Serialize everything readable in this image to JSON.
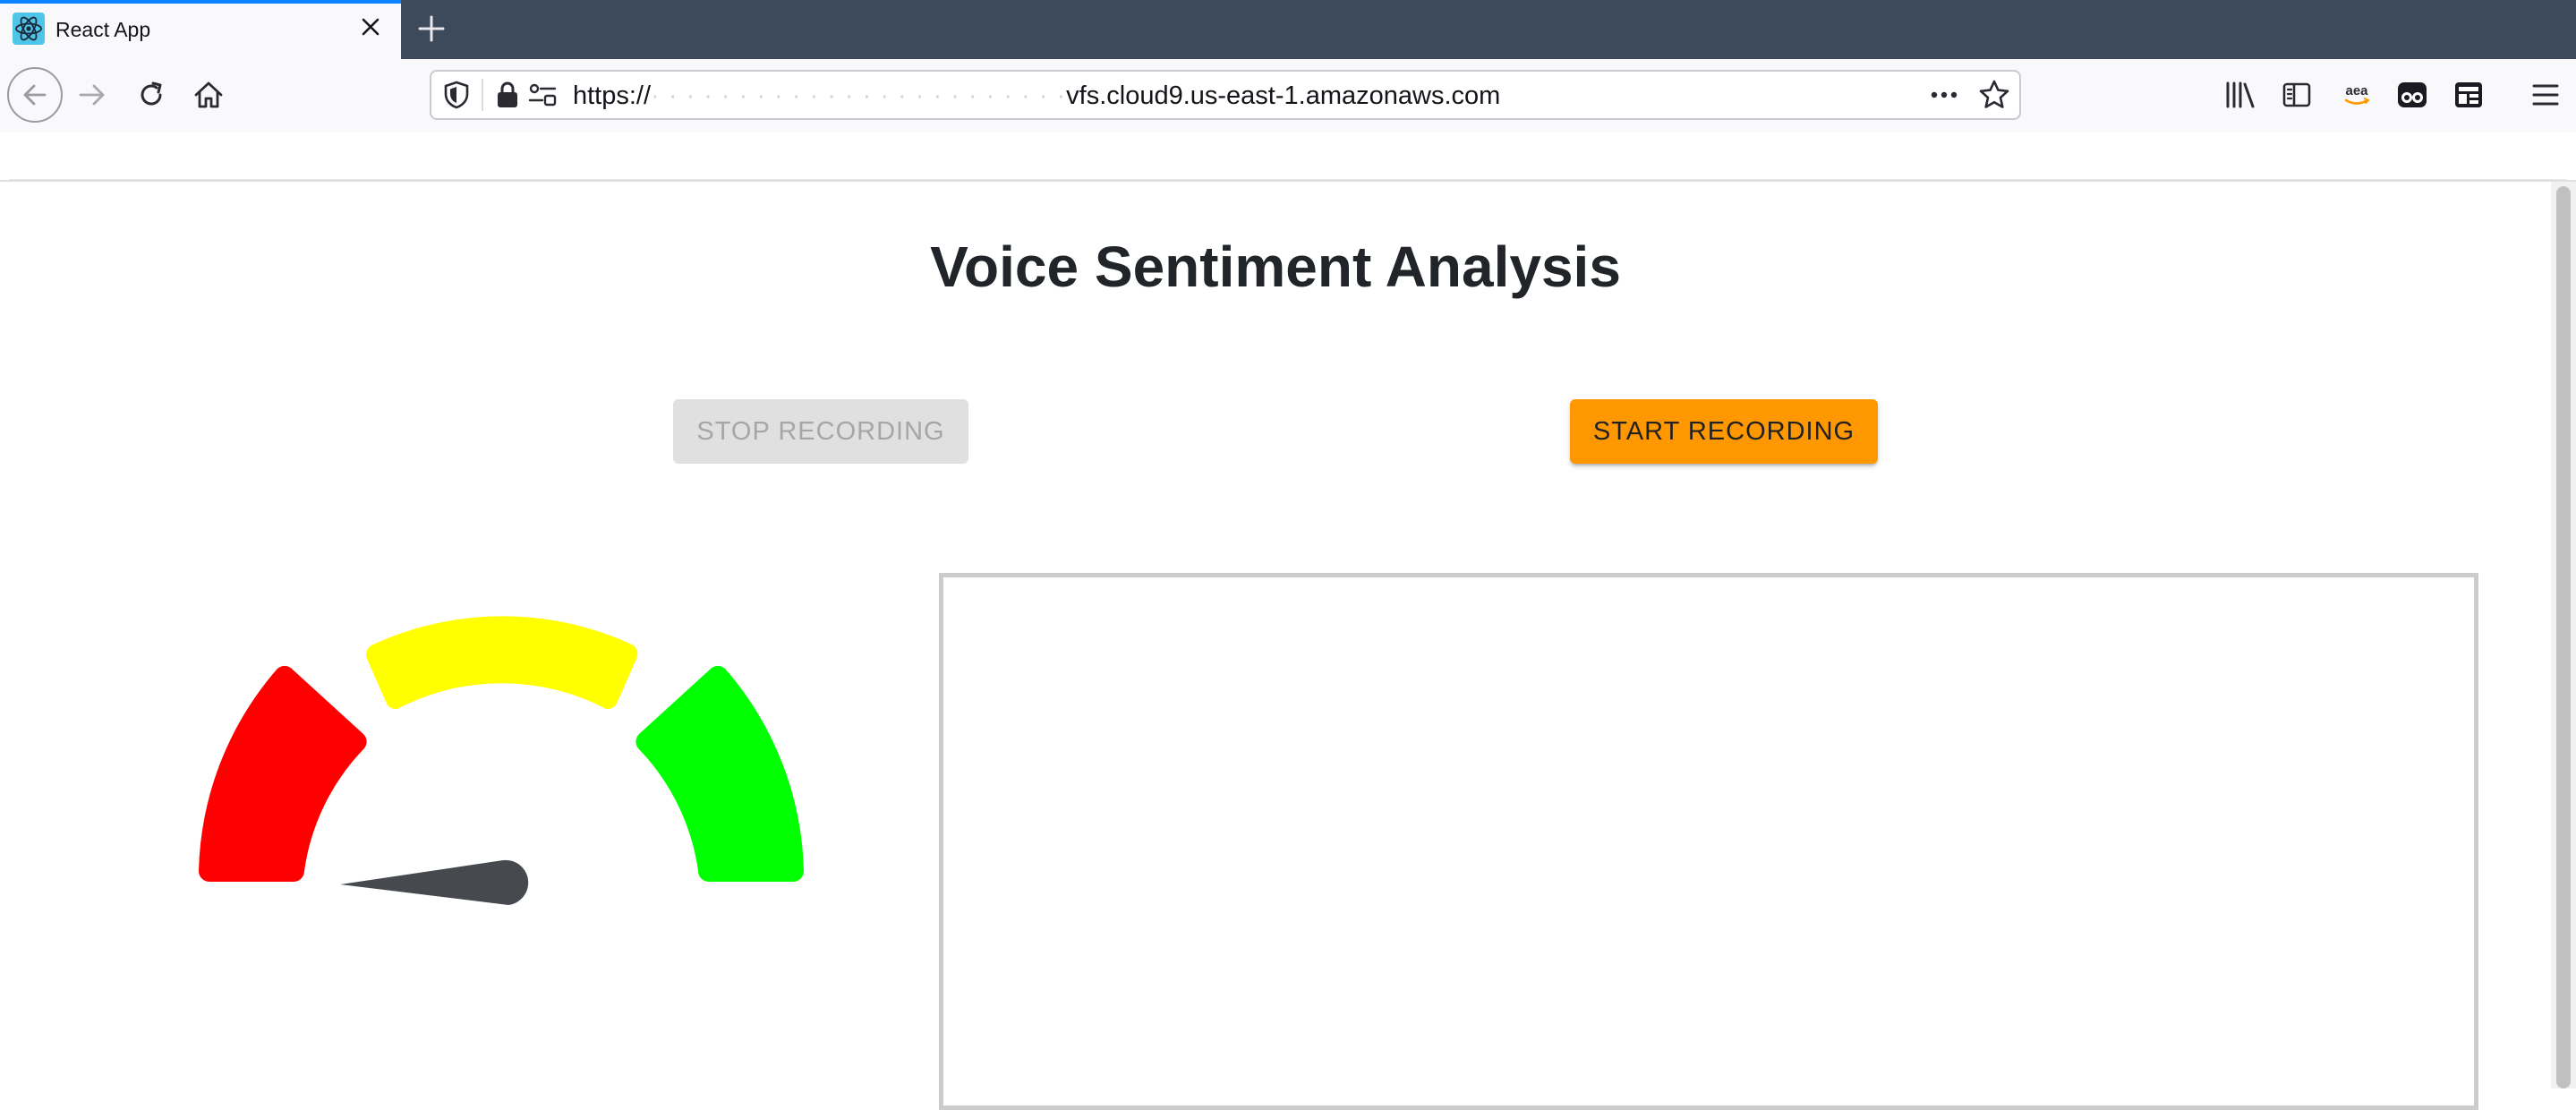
{
  "browser": {
    "tab": {
      "title": "React App",
      "favicon": "react-logo-icon"
    },
    "url": {
      "visible_start": "https://",
      "redacted": "·  ·  ·  ·  ·   ·  ·  ·  ·  ·  ·   ·  ·  ·  ·  ·  ·   ·  ·  ·  ·  ·  ·  ·",
      "visible_end": "vfs.cloud9.us-east-1.amazonaws.com"
    },
    "amazon_extension_label": "aea",
    "icons": [
      "back-arrow-icon",
      "forward-arrow-icon",
      "reload-icon",
      "home-icon",
      "shield-icon",
      "lock-icon",
      "permissions-icon",
      "more-icon",
      "star-icon",
      "library-icon",
      "sidebar-icon",
      "amazon-icon",
      "extension-icon",
      "extension-icon",
      "hamburger-menu-icon"
    ],
    "accent_color": "#0a84ff"
  },
  "page": {
    "title": "Voice Sentiment Analysis",
    "stop_button": "STOP RECORDING",
    "start_button": "START RECORDING",
    "start_button_color": "#ff9800",
    "gauge": {
      "segments": [
        {
          "name": "negative",
          "color": "#ff0000"
        },
        {
          "name": "neutral",
          "color": "#ffff00"
        },
        {
          "name": "positive",
          "color": "#00ff00"
        }
      ],
      "needle_color": "#464a4f",
      "needle_value": 0.04
    },
    "transcript_text": ""
  }
}
